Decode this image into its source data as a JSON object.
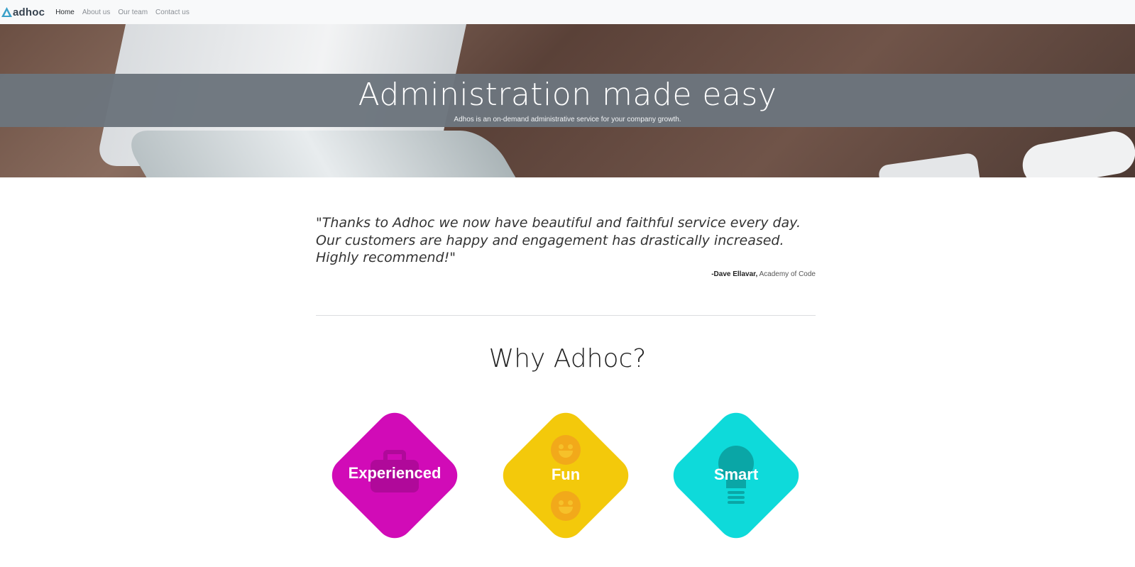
{
  "navbar": {
    "brand": "adhoc",
    "links": [
      "Home",
      "About us",
      "Our team",
      "Contact us"
    ],
    "active": "Home"
  },
  "hero": {
    "title": "Administration made easy",
    "subtitle": "Adhos is an on-demand administrative service for your company growth."
  },
  "testimonial": {
    "quote": "\"Thanks to Adhoc we now have beautiful and faithful service every day. Our customers are happy and engagement has drastically increased. Highly recommend!\"",
    "author": "-Dave Ellavar,",
    "organization": "Academy of Code"
  },
  "why": {
    "title": "Why Adhoc?",
    "tiles": [
      {
        "label": "Experienced",
        "color": "#d10bb7",
        "icon": "briefcase-icon"
      },
      {
        "label": "Fun",
        "color": "#f3c90b",
        "icon": "smiley-icon"
      },
      {
        "label": "Smart",
        "color": "#0edada",
        "icon": "lightbulb-icon"
      }
    ]
  },
  "colors": {
    "navbar_bg": "#f8f9fa",
    "hero_band": "#6c757d"
  }
}
